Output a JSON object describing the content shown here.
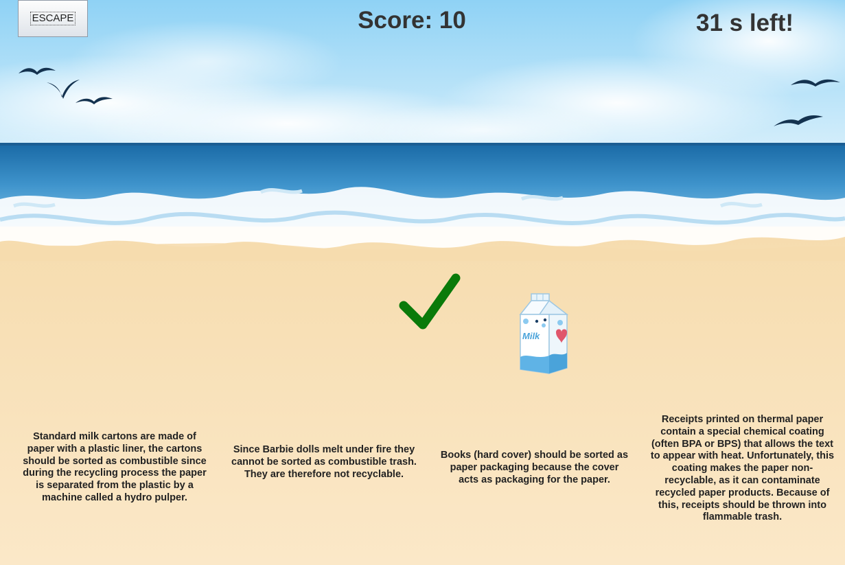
{
  "hud": {
    "escape_label": "ESCAPE",
    "score_text": "Score: 10",
    "timer_text": "31 s left!"
  },
  "item": {
    "label": "Milk",
    "icon": "milk-carton-icon"
  },
  "feedback": {
    "icon": "checkmark-icon",
    "color": "#0a7a0a"
  },
  "facts": [
    "Standard milk cartons are made of paper with a plastic liner, the cartons should be sorted as combustible since during the recycling process the paper is separated from the plastic by a machine called a hydro pulper.",
    "Since Barbie dolls melt under fire they cannot be sorted as combustible trash. They are therefore not recyclable.",
    "Books (hard cover) should be sorted as paper packaging because the cover acts as packaging for the paper.",
    "Receipts printed on thermal paper contain a special chemical coating (often BPA or BPS) that allows the text to appear with heat. Unfortunately, this coating makes the paper non-recyclable, as it can contaminate recycled paper products. Because of this, receipts should be thrown into flammable trash."
  ],
  "colors": {
    "sky": "#a9def7",
    "sea": "#2e7fb8",
    "foam": "#ffffff",
    "sand": "#f8e2b8",
    "text": "#222222"
  }
}
